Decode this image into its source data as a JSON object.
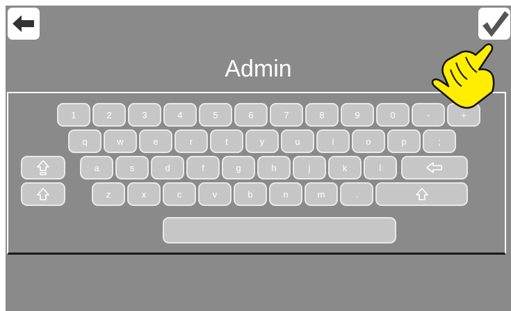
{
  "header": {
    "title": "Admin",
    "back_icon": "arrow-left-icon",
    "confirm_icon": "checkmark-icon"
  },
  "keyboard": {
    "row1": [
      "1",
      "2",
      "3",
      "4",
      "5",
      "6",
      "7",
      "8",
      "9",
      "0",
      "-",
      "+"
    ],
    "row2": [
      "q",
      "w",
      "e",
      "r",
      "t",
      "y",
      "u",
      "i",
      "o",
      "p",
      ";"
    ],
    "row3": [
      "a",
      "s",
      "d",
      "f",
      "g",
      "h",
      "j",
      "k",
      "l"
    ],
    "row4": [
      "z",
      "x",
      "c",
      "v",
      "b",
      "n",
      "m",
      "."
    ],
    "special_keys": {
      "caps_lock_icon": "caps-lock-icon",
      "backspace_icon": "backspace-arrow-icon",
      "shift_icon": "shift-arrow-icon",
      "space_label": ""
    }
  },
  "overlay": {
    "pointer_icon": "pointing-hand-icon",
    "pointer_color": "#ffee00"
  },
  "colors": {
    "background": "#8a8a8a",
    "key_fill": "#c6c6c6",
    "key_border": "#e9e9e9",
    "text": "#ffffff"
  }
}
